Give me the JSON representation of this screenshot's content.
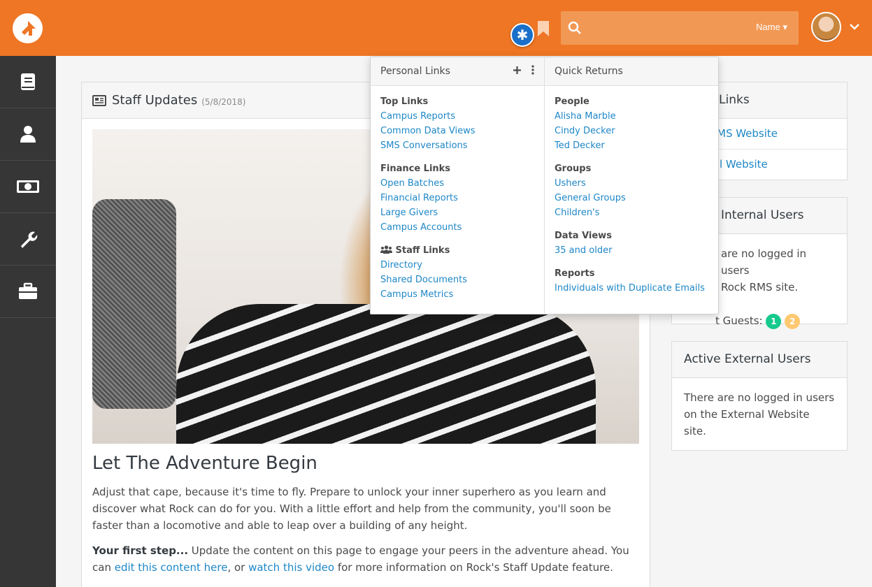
{
  "header": {
    "search_scope": "Name"
  },
  "sidebar": {
    "items": [
      {
        "icon": "book-icon"
      },
      {
        "icon": "person-icon"
      },
      {
        "icon": "money-icon"
      },
      {
        "icon": "wrench-icon"
      },
      {
        "icon": "briefcase-icon"
      }
    ]
  },
  "staff_updates": {
    "title": "Staff Updates",
    "date": "(5/8/2018)",
    "article_title": "Let The Adventure Begin",
    "paragraph1": "Adjust that cape, because it's time to fly. Prepare to unlock your inner superhero as you learn and discover what Rock can do for you. With a little effort and help from the community, you'll soon be faster than a locomotive and able to leap over a building of any height.",
    "p2_bold": "Your first step...",
    "p2_text1": " Update the content on this page to engage your peers in the adventure ahead. You can ",
    "p2_link1": "edit this content here",
    "p2_text2": ", or ",
    "p2_link2": "watch this video",
    "p2_text3": " for more information on Rock's Staff Update feature."
  },
  "links_panel": {
    "title": "Links",
    "items": [
      "MS Website",
      "l Website"
    ]
  },
  "internal_users": {
    "title": "Internal Users",
    "line1": "are no logged in users",
    "line2": "Rock RMS site.",
    "guests_label": "t Guests:",
    "badge1": "1",
    "badge2": "2"
  },
  "external_users": {
    "title": "Active External Users",
    "text": "There are no logged in users on the External Website site."
  },
  "personal_links": {
    "title": "Personal Links",
    "groups": [
      {
        "title": "Top Links",
        "links": [
          "Campus Reports",
          "Common Data Views",
          "SMS Conversations"
        ]
      },
      {
        "title": "Finance Links",
        "links": [
          "Open Batches",
          "Financial Reports",
          "Large Givers",
          "Campus Accounts"
        ]
      },
      {
        "title": "Staff Links",
        "links": [
          "Directory",
          "Shared Documents",
          "Campus Metrics"
        ]
      }
    ]
  },
  "quick_returns": {
    "title": "Quick Returns",
    "groups": [
      {
        "title": "People",
        "links": [
          "Alisha Marble",
          "Cindy Decker",
          "Ted Decker"
        ]
      },
      {
        "title": "Groups",
        "links": [
          "Ushers",
          "General Groups",
          "Children's"
        ]
      },
      {
        "title": "Data Views",
        "links": [
          "35 and older"
        ]
      },
      {
        "title": "Reports",
        "links": [
          "Individuals with Duplicate Emails"
        ]
      }
    ]
  },
  "colors": {
    "brand": "#ee7624",
    "sidebar": "#363636",
    "link": "#1e87c7",
    "badge_green": "#16c98d",
    "badge_yellow": "#ffc870"
  }
}
